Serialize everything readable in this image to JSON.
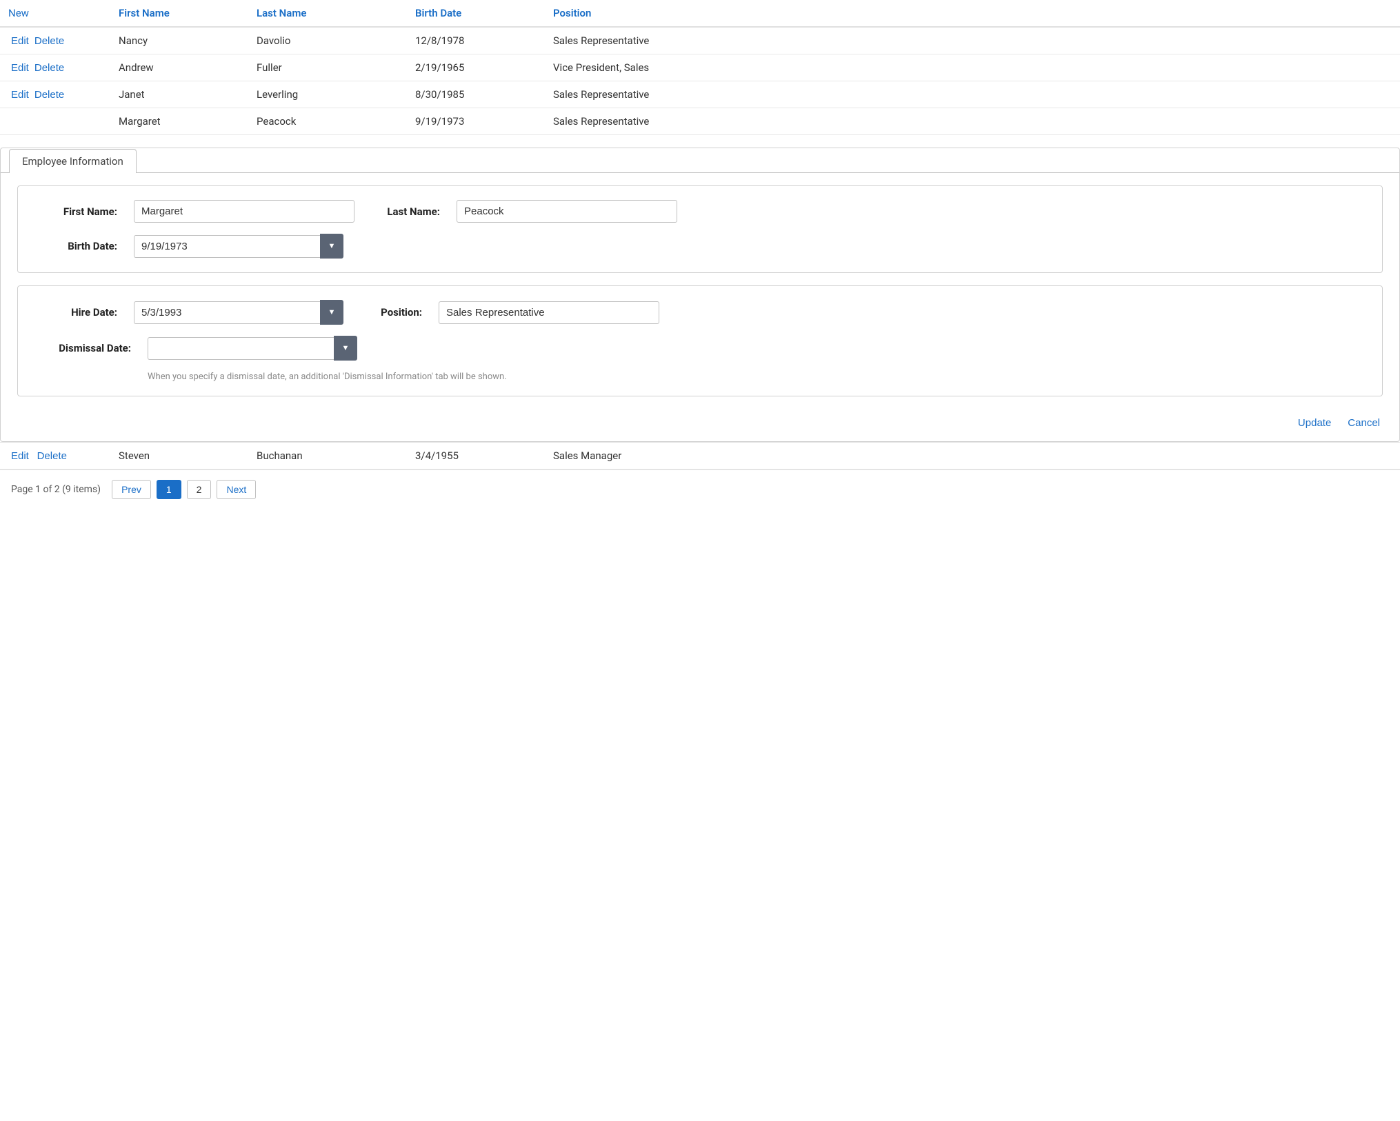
{
  "table": {
    "columns": [
      {
        "label": "New",
        "key": "new"
      },
      {
        "label": "First Name",
        "key": "firstName"
      },
      {
        "label": "Last Name",
        "key": "lastName"
      },
      {
        "label": "Birth Date",
        "key": "birthDate"
      },
      {
        "label": "Position",
        "key": "position"
      }
    ],
    "rows": [
      {
        "id": 1,
        "firstName": "Nancy",
        "lastName": "Davolio",
        "birthDate": "12/8/1978",
        "position": "Sales Representative",
        "hasEditDelete": true
      },
      {
        "id": 2,
        "firstName": "Andrew",
        "lastName": "Fuller",
        "birthDate": "2/19/1965",
        "position": "Vice President, Sales",
        "hasEditDelete": true
      },
      {
        "id": 3,
        "firstName": "Janet",
        "lastName": "Leverling",
        "birthDate": "8/30/1985",
        "position": "Sales Representative",
        "hasEditDelete": true
      },
      {
        "id": 4,
        "firstName": "Margaret",
        "lastName": "Peacock",
        "birthDate": "9/19/1973",
        "position": "Sales Representative",
        "hasEditDelete": false,
        "selected": true
      }
    ],
    "bottomRow": {
      "firstName": "Steven",
      "lastName": "Buchanan",
      "birthDate": "3/4/1955",
      "position": "Sales Manager",
      "hasEditDelete": true
    }
  },
  "editLabels": {
    "edit": "Edit",
    "delete": "Delete"
  },
  "employeeInfo": {
    "tabLabel": "Employee Information",
    "panel1": {
      "firstNameLabel": "First Name:",
      "firstNameValue": "Margaret",
      "lastNameLabel": "Last Name:",
      "lastNameValue": "Peacock",
      "birthDateLabel": "Birth Date:",
      "birthDateValue": "9/19/1973"
    },
    "panel2": {
      "hireDateLabel": "Hire Date:",
      "hireDateValue": "5/3/1993",
      "positionLabel": "Position:",
      "positionValue": "Sales Representative",
      "dismissalDateLabel": "Dismissal Date:",
      "dismissalDateValue": "",
      "hintText": "When you specify a dismissal date, an additional 'Dismissal Information' tab will be shown."
    },
    "updateLabel": "Update",
    "cancelLabel": "Cancel"
  },
  "pagination": {
    "info": "Page 1 of 2 (9 items)",
    "prevLabel": "Prev",
    "nextLabel": "Next",
    "currentPage": 1,
    "totalPages": 2
  }
}
